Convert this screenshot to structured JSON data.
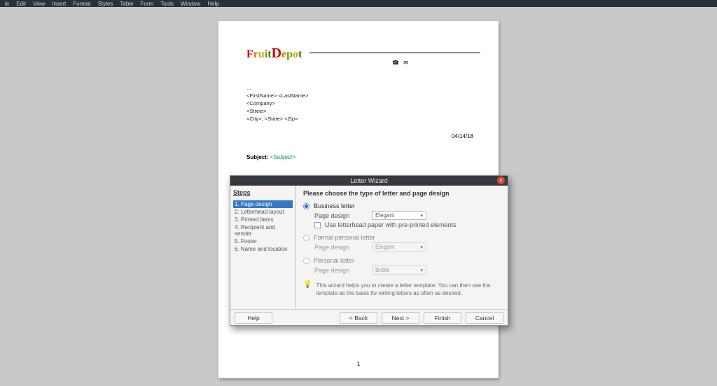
{
  "menubar": [
    "le",
    "Edit",
    "View",
    "Insert",
    "Format",
    "Styles",
    "Table",
    "Form",
    "Tools",
    "Window",
    "Help"
  ],
  "document": {
    "logo_glyphs": [
      "F",
      "r",
      "u",
      "i",
      "t",
      "D",
      "e",
      "p",
      "o",
      "t"
    ],
    "phone_glyphs": "☎ ✉",
    "ellipsis": "…",
    "addr_lines": [
      "<FirstName> <LastName>",
      "<Company>",
      "<Street>",
      "<City>, <State> <Zip>"
    ],
    "date": "04/14/18",
    "subject_label": "Subject:",
    "subject_merge": "<Subject>",
    "page_number": "1"
  },
  "wizard": {
    "title": "Letter Wizard",
    "close_glyph": "×",
    "steps_title": "Steps",
    "steps": [
      "1. Page design",
      "2. Letterhead layout",
      "3. Printed items",
      "4. Recipient and sender",
      "5. Footer",
      "6. Name and location"
    ],
    "heading": "Please choose the type of letter and page design",
    "opt_business": "Business letter",
    "lbl_page_design": "Page design",
    "sel_business": "Elegant",
    "chk_preprinted": "Use letterhead paper with pre-printed elements",
    "opt_formal": "Formal personal letter",
    "sel_formal": "Elegant",
    "opt_personal": "Personal letter",
    "sel_personal": "Bottle",
    "hint": "This wizard helps you to create a letter template. You can then use the template as the basis for writing letters as often as desired.",
    "bulb": "💡",
    "btn_help": "Help",
    "btn_back": "< Back",
    "btn_next": "Next >",
    "btn_finish": "Finish",
    "btn_cancel": "Cancel"
  }
}
